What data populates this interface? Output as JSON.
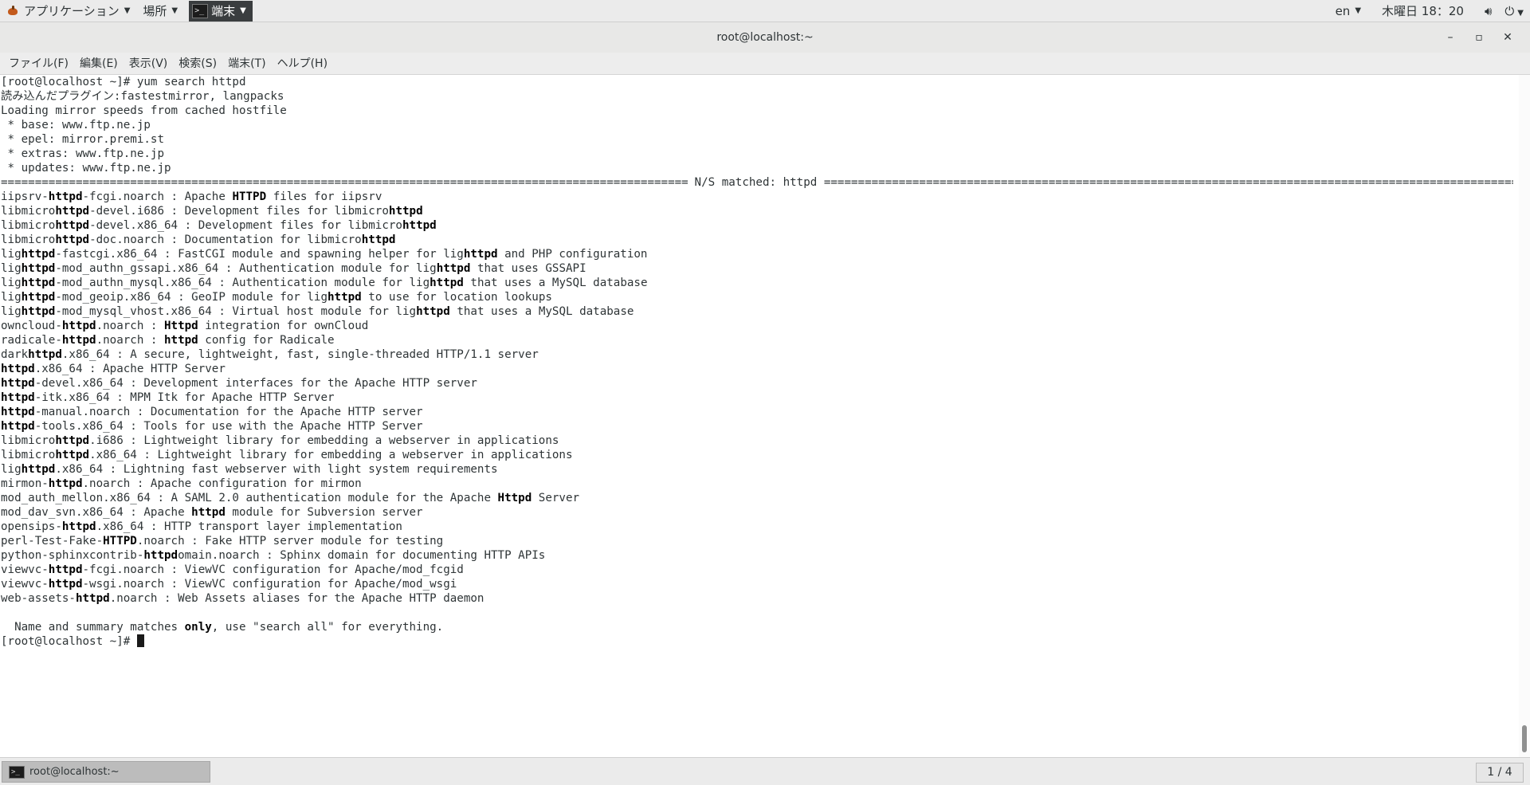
{
  "top_panel": {
    "applications_label": "アプリケーション",
    "places_label": "場所",
    "task_label": "端末",
    "input_method": "en",
    "clock": "木曜日 18：20"
  },
  "window": {
    "title": "root@localhost:~",
    "minimize_glyph": "–",
    "maximize_glyph": "▫",
    "close_glyph": "✕"
  },
  "menubar": {
    "items": [
      "ファイル(F)",
      "編集(E)",
      "表示(V)",
      "検索(S)",
      "端末(T)",
      "ヘルプ(H)"
    ]
  },
  "terminal": {
    "header_lines": [
      "[root@localhost ~]# yum search httpd",
      "読み込んだプラグイン:fastestmirror, langpacks",
      "Loading mirror speeds from cached hostfile",
      " * base: www.ftp.ne.jp",
      " * epel: mirror.premi.st",
      " * extras: www.ftp.ne.jp",
      " * updates: www.ftp.ne.jp"
    ],
    "separator_label": " N/S matched: httpd ",
    "results": [
      [
        [
          "iipsrv-",
          false
        ],
        [
          "httpd",
          true
        ],
        [
          "-fcgi.noarch : Apache ",
          false
        ],
        [
          "HTTPD",
          true
        ],
        [
          " files for iipsrv",
          false
        ]
      ],
      [
        [
          "libmicro",
          false
        ],
        [
          "httpd",
          true
        ],
        [
          "-devel.i686 : Development files for libmicro",
          false
        ],
        [
          "httpd",
          true
        ]
      ],
      [
        [
          "libmicro",
          false
        ],
        [
          "httpd",
          true
        ],
        [
          "-devel.x86_64 : Development files for libmicro",
          false
        ],
        [
          "httpd",
          true
        ]
      ],
      [
        [
          "libmicro",
          false
        ],
        [
          "httpd",
          true
        ],
        [
          "-doc.noarch : Documentation for libmicro",
          false
        ],
        [
          "httpd",
          true
        ]
      ],
      [
        [
          "lig",
          false
        ],
        [
          "httpd",
          true
        ],
        [
          "-fastcgi.x86_64 : FastCGI module and spawning helper for lig",
          false
        ],
        [
          "httpd",
          true
        ],
        [
          " and PHP configuration",
          false
        ]
      ],
      [
        [
          "lig",
          false
        ],
        [
          "httpd",
          true
        ],
        [
          "-mod_authn_gssapi.x86_64 : Authentication module for lig",
          false
        ],
        [
          "httpd",
          true
        ],
        [
          " that uses GSSAPI",
          false
        ]
      ],
      [
        [
          "lig",
          false
        ],
        [
          "httpd",
          true
        ],
        [
          "-mod_authn_mysql.x86_64 : Authentication module for lig",
          false
        ],
        [
          "httpd",
          true
        ],
        [
          " that uses a MySQL database",
          false
        ]
      ],
      [
        [
          "lig",
          false
        ],
        [
          "httpd",
          true
        ],
        [
          "-mod_geoip.x86_64 : GeoIP module for lig",
          false
        ],
        [
          "httpd",
          true
        ],
        [
          " to use for location lookups",
          false
        ]
      ],
      [
        [
          "lig",
          false
        ],
        [
          "httpd",
          true
        ],
        [
          "-mod_mysql_vhost.x86_64 : Virtual host module for lig",
          false
        ],
        [
          "httpd",
          true
        ],
        [
          " that uses a MySQL database",
          false
        ]
      ],
      [
        [
          "owncloud-",
          false
        ],
        [
          "httpd",
          true
        ],
        [
          ".noarch : ",
          false
        ],
        [
          "Httpd",
          true
        ],
        [
          " integration for ownCloud",
          false
        ]
      ],
      [
        [
          "radicale-",
          false
        ],
        [
          "httpd",
          true
        ],
        [
          ".noarch : ",
          false
        ],
        [
          "httpd",
          true
        ],
        [
          " config for Radicale",
          false
        ]
      ],
      [
        [
          "dark",
          false
        ],
        [
          "httpd",
          true
        ],
        [
          ".x86_64 : A secure, lightweight, fast, single-threaded HTTP/1.1 server",
          false
        ]
      ],
      [
        [
          "httpd",
          true
        ],
        [
          ".x86_64 : Apache HTTP Server",
          false
        ]
      ],
      [
        [
          "httpd",
          true
        ],
        [
          "-devel.x86_64 : Development interfaces for the Apache HTTP server",
          false
        ]
      ],
      [
        [
          "httpd",
          true
        ],
        [
          "-itk.x86_64 : MPM Itk for Apache HTTP Server",
          false
        ]
      ],
      [
        [
          "httpd",
          true
        ],
        [
          "-manual.noarch : Documentation for the Apache HTTP server",
          false
        ]
      ],
      [
        [
          "httpd",
          true
        ],
        [
          "-tools.x86_64 : Tools for use with the Apache HTTP Server",
          false
        ]
      ],
      [
        [
          "libmicro",
          false
        ],
        [
          "httpd",
          true
        ],
        [
          ".i686 : Lightweight library for embedding a webserver in applications",
          false
        ]
      ],
      [
        [
          "libmicro",
          false
        ],
        [
          "httpd",
          true
        ],
        [
          ".x86_64 : Lightweight library for embedding a webserver in applications",
          false
        ]
      ],
      [
        [
          "lig",
          false
        ],
        [
          "httpd",
          true
        ],
        [
          ".x86_64 : Lightning fast webserver with light system requirements",
          false
        ]
      ],
      [
        [
          "mirmon-",
          false
        ],
        [
          "httpd",
          true
        ],
        [
          ".noarch : Apache configuration for mirmon",
          false
        ]
      ],
      [
        [
          "mod_auth_mellon.x86_64 : A SAML 2.0 authentication module for the Apache ",
          false
        ],
        [
          "Httpd",
          true
        ],
        [
          " Server",
          false
        ]
      ],
      [
        [
          "mod_dav_svn.x86_64 : Apache ",
          false
        ],
        [
          "httpd",
          true
        ],
        [
          " module for Subversion server",
          false
        ]
      ],
      [
        [
          "opensips-",
          false
        ],
        [
          "httpd",
          true
        ],
        [
          ".x86_64 : HTTP transport layer implementation",
          false
        ]
      ],
      [
        [
          "perl-Test-Fake-",
          false
        ],
        [
          "HTTPD",
          true
        ],
        [
          ".noarch : Fake HTTP server module for testing",
          false
        ]
      ],
      [
        [
          "python-sphinxcontrib-",
          false
        ],
        [
          "httpd",
          true
        ],
        [
          "omain.noarch : Sphinx domain for documenting HTTP APIs",
          false
        ]
      ],
      [
        [
          "viewvc-",
          false
        ],
        [
          "httpd",
          true
        ],
        [
          "-fcgi.noarch : ViewVC configuration for Apache/mod_fcgid",
          false
        ]
      ],
      [
        [
          "viewvc-",
          false
        ],
        [
          "httpd",
          true
        ],
        [
          "-wsgi.noarch : ViewVC configuration for Apache/mod_wsgi",
          false
        ]
      ],
      [
        [
          "web-assets-",
          false
        ],
        [
          "httpd",
          true
        ],
        [
          ".noarch : Web Assets aliases for the Apache HTTP daemon",
          false
        ]
      ]
    ],
    "footer_note": [
      [
        "  Name and summary matches ",
        false
      ],
      [
        "only",
        true
      ],
      [
        ", use \"search all\" for everything.",
        false
      ]
    ],
    "prompt": "[root@localhost ~]# "
  },
  "bottom_panel": {
    "task_label": "root@localhost:~",
    "workspace": "1 / 4"
  }
}
